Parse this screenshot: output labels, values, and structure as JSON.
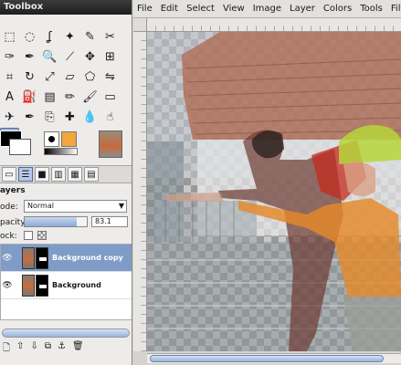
{
  "toolbox": {
    "title": "Toolbox",
    "tools": [
      [
        "rect-select-icon",
        "ellipse-select-icon",
        "free-select-icon",
        "fuzzy-select-icon",
        "color-select-icon",
        "scissors-icon"
      ],
      [
        "paths-icon",
        "color-picker-icon",
        "zoom-icon",
        "measure-icon",
        "move-icon",
        "align-icon"
      ],
      [
        "crop-icon",
        "rotate-icon",
        "scale-icon",
        "shear-icon",
        "perspective-icon",
        "flip-icon"
      ],
      [
        "text-icon",
        "bucket-fill-icon",
        "blend-icon",
        "pencil-icon",
        "paintbrush-icon",
        "eraser-icon"
      ],
      [
        "airbrush-icon",
        "ink-icon",
        "clone-icon",
        "heal-icon",
        "blur-icon",
        "smudge-icon"
      ],
      [
        "dodge-icon"
      ]
    ],
    "tool_glyphs": [
      [
        "⬚",
        "◌",
        "ʆ",
        "✦",
        "✎",
        "✂"
      ],
      [
        "✑",
        "✒",
        "🔍",
        "⟋",
        "✥",
        "⊞"
      ],
      [
        "⌗",
        "↻",
        "⤢",
        "▱",
        "⬠",
        "⇋"
      ],
      [
        "A",
        "⛽",
        "▤",
        "✏",
        "🖌",
        "▭"
      ],
      [
        "✈",
        "✒",
        "⎘",
        "✚",
        "💧",
        "☝"
      ],
      [
        "◐"
      ]
    ],
    "active_tool": "dodge-icon"
  },
  "layers": {
    "title": "ayers",
    "mode_label": "ode:",
    "mode_value": "Normal",
    "opacity_label": "pacity:",
    "opacity_value": "83.1",
    "opacity_level": 0.831,
    "lock_label": "ock:",
    "list": [
      {
        "name": "Background copy",
        "selected": true
      },
      {
        "name": "Background",
        "selected": false
      }
    ]
  },
  "image_window": {
    "menu": [
      "File",
      "Edit",
      "Select",
      "View",
      "Image",
      "Layer",
      "Colors",
      "Tools",
      "Filters"
    ]
  },
  "colors": {
    "selection": "#7e9cc7",
    "accent": "#9ab3d9"
  }
}
